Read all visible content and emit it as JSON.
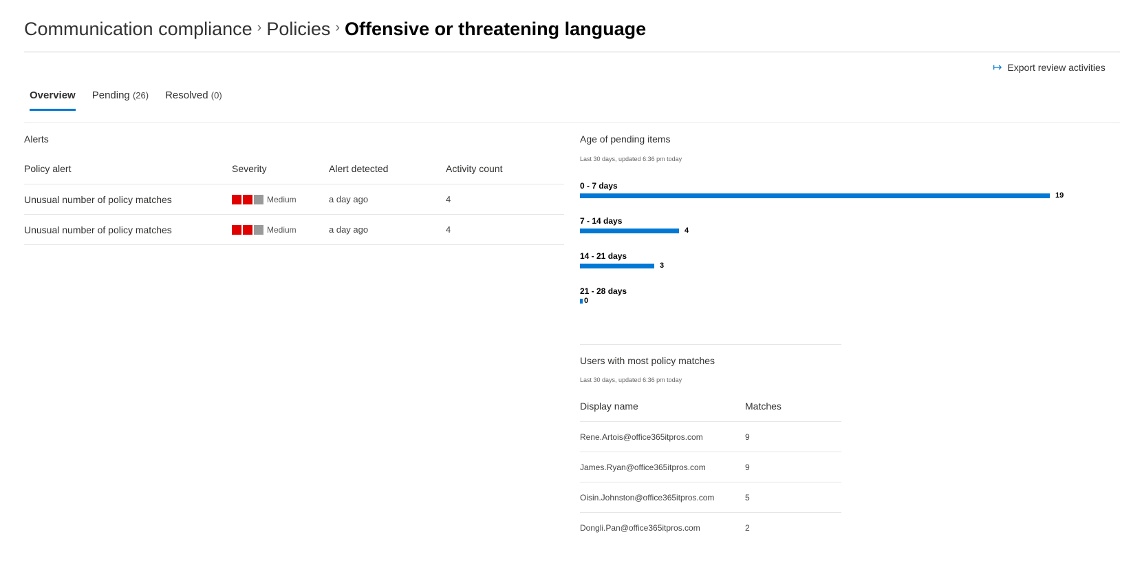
{
  "breadcrumb": {
    "items": [
      "Communication compliance",
      "Policies"
    ],
    "separator": ">",
    "current": "Offensive or threatening language"
  },
  "toolbar": {
    "export_icon": "export-arrow-icon",
    "export_label": "Export review activities"
  },
  "tabs": [
    {
      "label": "Overview",
      "count": "",
      "active": true
    },
    {
      "label": "Pending",
      "count": "(26)",
      "active": false
    },
    {
      "label": "Resolved",
      "count": "(0)",
      "active": false
    }
  ],
  "alerts": {
    "title": "Alerts",
    "columns": [
      "Policy alert",
      "Severity",
      "Alert detected",
      "Activity count"
    ],
    "rows": [
      {
        "policy_alert": "Unusual number of policy matches",
        "severity": "Medium",
        "severity_level": 2,
        "severity_max": 3,
        "detected": "a day ago",
        "count": "4"
      },
      {
        "policy_alert": "Unusual number of policy matches",
        "severity": "Medium",
        "severity_level": 2,
        "severity_max": 3,
        "detected": "a day ago",
        "count": "4"
      }
    ],
    "severity_colors": {
      "filled": "#e00000",
      "empty": "#999999"
    }
  },
  "age": {
    "title": "Age of pending items",
    "subtitle": "Last 30 days, updated 6:36 pm today"
  },
  "chart_data": {
    "type": "bar",
    "orientation": "horizontal",
    "title": "Age of pending items",
    "subtitle": "Last 30 days, updated 6:36 pm today",
    "categories": [
      "0 - 7 days",
      "7 - 14 days",
      "14 - 21 days",
      "21 - 28 days"
    ],
    "values": [
      19,
      4,
      3,
      0
    ],
    "xlabel": "",
    "ylabel": "",
    "xlim": [
      0,
      19
    ],
    "grid": false,
    "data_labels": true,
    "color": "#0078d4"
  },
  "users": {
    "title": "Users with most policy matches",
    "subtitle": "Last 30 days, updated 6:36 pm today",
    "columns": [
      "Display name",
      "Matches"
    ],
    "rows": [
      {
        "name": "Rene.Artois@office365itpros.com",
        "matches": "9"
      },
      {
        "name": "James.Ryan@office365itpros.com",
        "matches": "9"
      },
      {
        "name": "Oisin.Johnston@office365itpros.com",
        "matches": "5"
      },
      {
        "name": "Dongli.Pan@office365itpros.com",
        "matches": "2"
      }
    ]
  },
  "colors": {
    "accent": "#0078d4"
  }
}
